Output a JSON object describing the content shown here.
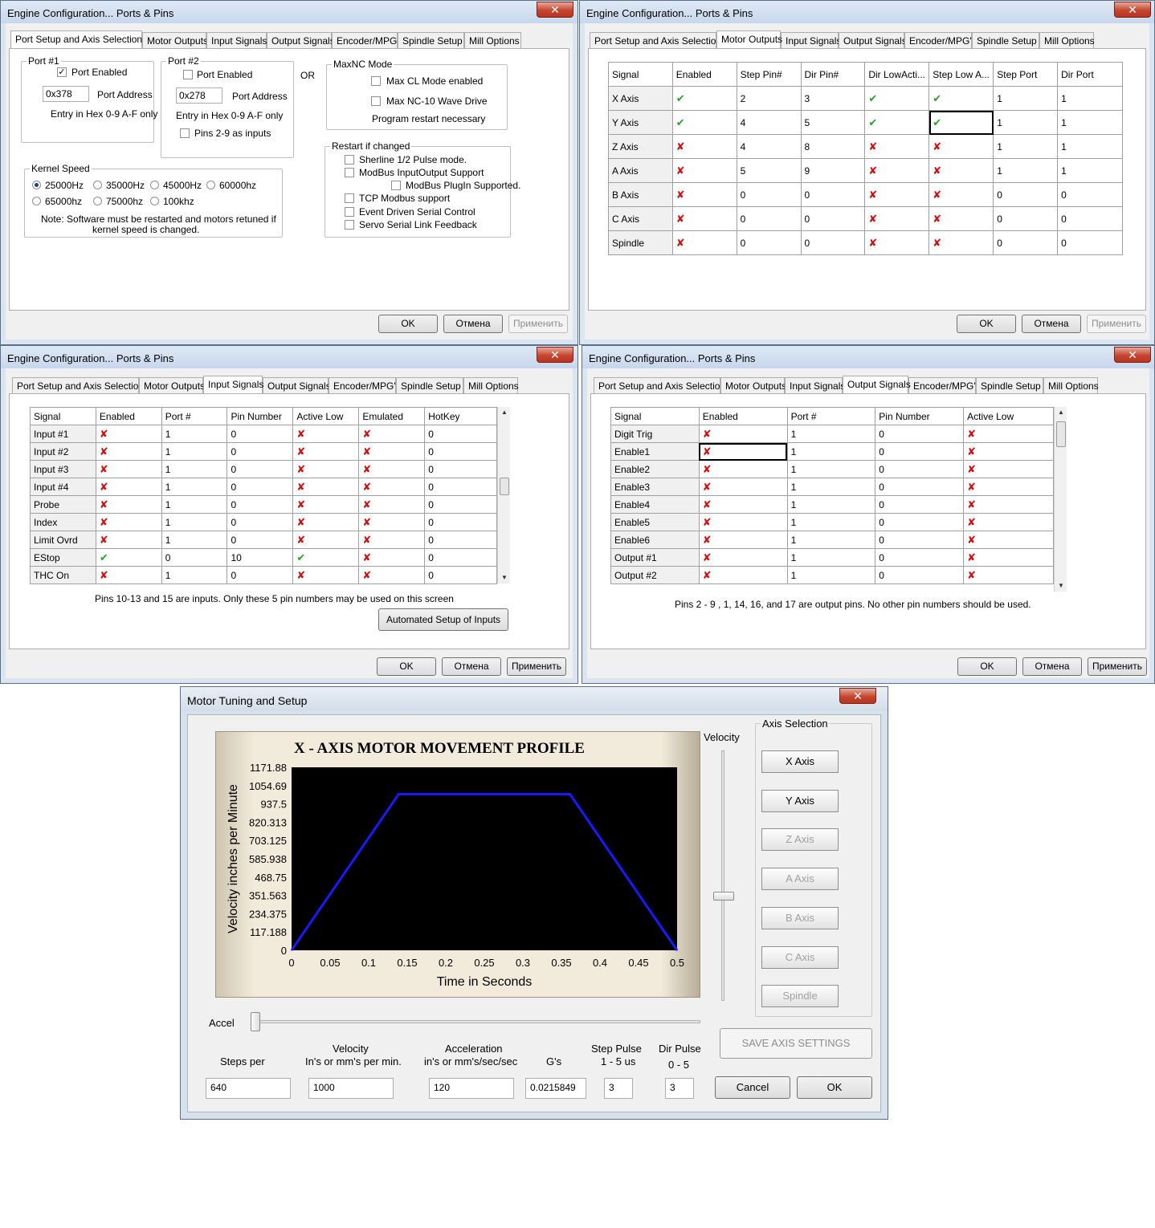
{
  "engine": {
    "title": "Engine Configuration... Ports & Pins",
    "close_glyph": "✕",
    "tabs": [
      "Port Setup and Axis Selection",
      "Motor Outputs",
      "Input Signals",
      "Output Signals",
      "Encoder/MPG's",
      "Spindle Setup",
      "Mill Options"
    ],
    "buttons": {
      "ok": "OK",
      "cancel": "Отмена",
      "apply": "Применить"
    }
  },
  "port_setup": {
    "port1": {
      "label": "Port #1",
      "enabled_label": "Port Enabled",
      "enabled": true,
      "address": "0x378",
      "address_label": "Port Address",
      "hint": "Entry in Hex 0-9 A-F only"
    },
    "or_label": "OR",
    "port2": {
      "label": "Port #2",
      "enabled_label": "Port Enabled",
      "enabled": false,
      "address": "0x278",
      "address_label": "Port Address",
      "hint": "Entry in Hex 0-9 A-F only",
      "pins_label": "Pins 2-9 as inputs"
    },
    "maxnc": {
      "label": "MaxNC Mode",
      "opt1": "Max CL Mode enabled",
      "opt2": "Max NC-10 Wave Drive",
      "note": "Program restart necessary"
    },
    "restart": {
      "label": "Restart if changed",
      "opts": [
        "Sherline 1/2 Pulse mode.",
        "ModBus InputOutput Support",
        "ModBus PlugIn Supported.",
        "TCP Modbus support",
        "Event Driven Serial Control",
        "Servo Serial Link Feedback"
      ]
    },
    "kernel": {
      "label": "Kernel Speed",
      "opts": [
        "25000Hz",
        "35000Hz",
        "45000Hz",
        "60000hz",
        "65000hz",
        "75000hz",
        "100khz"
      ],
      "selected": "25000Hz",
      "note1": "Note: Software must be restarted and motors retuned if",
      "note2": "kernel speed is changed."
    }
  },
  "motor_outputs": {
    "headers": [
      "Signal",
      "Enabled",
      "Step Pin#",
      "Dir Pin#",
      "Dir LowActi...",
      "Step Low A...",
      "Step Port",
      "Dir Port"
    ],
    "rows": [
      [
        "X Axis",
        "y",
        "2",
        "3",
        "y",
        "y",
        "1",
        "1"
      ],
      [
        "Y Axis",
        "y",
        "4",
        "5",
        "y",
        "y",
        "1",
        "1"
      ],
      [
        "Z Axis",
        "n",
        "4",
        "8",
        "n",
        "n",
        "1",
        "1"
      ],
      [
        "A Axis",
        "n",
        "5",
        "9",
        "n",
        "n",
        "1",
        "1"
      ],
      [
        "B Axis",
        "n",
        "0",
        "0",
        "n",
        "n",
        "0",
        "0"
      ],
      [
        "C Axis",
        "n",
        "0",
        "0",
        "n",
        "n",
        "0",
        "0"
      ],
      [
        "Spindle",
        "n",
        "0",
        "0",
        "n",
        "n",
        "0",
        "0"
      ]
    ]
  },
  "input_signals": {
    "headers": [
      "Signal",
      "Enabled",
      "Port #",
      "Pin Number",
      "Active Low",
      "Emulated",
      "HotKey"
    ],
    "rows": [
      [
        "Input #1",
        "n",
        "1",
        "0",
        "n",
        "n",
        "0"
      ],
      [
        "Input #2",
        "n",
        "1",
        "0",
        "n",
        "n",
        "0"
      ],
      [
        "Input #3",
        "n",
        "1",
        "0",
        "n",
        "n",
        "0"
      ],
      [
        "Input #4",
        "n",
        "1",
        "0",
        "n",
        "n",
        "0"
      ],
      [
        "Probe",
        "n",
        "1",
        "0",
        "n",
        "n",
        "0"
      ],
      [
        "Index",
        "n",
        "1",
        "0",
        "n",
        "n",
        "0"
      ],
      [
        "Limit Ovrd",
        "n",
        "1",
        "0",
        "n",
        "n",
        "0"
      ],
      [
        "EStop",
        "y",
        "0",
        "10",
        "y",
        "n",
        "0"
      ],
      [
        "THC On",
        "n",
        "1",
        "0",
        "n",
        "n",
        "0"
      ]
    ],
    "note": "Pins 10-13 and 15 are inputs. Only these 5 pin numbers may be used on this screen",
    "auto_button": "Automated Setup of Inputs"
  },
  "output_signals": {
    "headers": [
      "Signal",
      "Enabled",
      "Port #",
      "Pin Number",
      "Active Low"
    ],
    "rows": [
      [
        "Digit  Trig",
        "n",
        "1",
        "0",
        "n"
      ],
      [
        "Enable1",
        "n",
        "1",
        "0",
        "n"
      ],
      [
        "Enable2",
        "n",
        "1",
        "0",
        "n"
      ],
      [
        "Enable3",
        "n",
        "1",
        "0",
        "n"
      ],
      [
        "Enable4",
        "n",
        "1",
        "0",
        "n"
      ],
      [
        "Enable5",
        "n",
        "1",
        "0",
        "n"
      ],
      [
        "Enable6",
        "n",
        "1",
        "0",
        "n"
      ],
      [
        "Output #1",
        "n",
        "1",
        "0",
        "n"
      ],
      [
        "Output #2",
        "n",
        "1",
        "0",
        "n"
      ]
    ],
    "note": "Pins 2 - 9 , 1, 14, 16, and 17 are output pins.  No  other pin numbers should be used."
  },
  "motor_tuning": {
    "title": "Motor Tuning and Setup",
    "close_glyph": "✕",
    "velocity_label": "Velocity",
    "accel_label": "Accel",
    "axis_group_label": "Axis Selection",
    "axis_buttons": [
      {
        "label": "X Axis",
        "enabled": true
      },
      {
        "label": "Y Axis",
        "enabled": true
      },
      {
        "label": "Z Axis",
        "enabled": false
      },
      {
        "label": "A Axis",
        "enabled": false
      },
      {
        "label": "B Axis",
        "enabled": false
      },
      {
        "label": "C Axis",
        "enabled": false
      },
      {
        "label": "Spindle",
        "enabled": false
      }
    ],
    "save_button": "SAVE AXIS SETTINGS",
    "cancel_button": "Cancel",
    "ok_button": "OK",
    "fields": {
      "steps_label": "Steps per",
      "steps_value": "640",
      "velocity_label1": "Velocity",
      "velocity_label2": "In's or mm's per min.",
      "velocity_value": "1000",
      "accel_label1": "Acceleration",
      "accel_label2": "in's or mm's/sec/sec",
      "accel_value": "120",
      "gs_label": "G's",
      "gs_value": "0.0215849",
      "step_pulse_label1": "Step Pulse",
      "step_pulse_label2": "1 - 5 us",
      "step_pulse_value": "3",
      "dir_pulse_label1": "Dir Pulse",
      "dir_pulse_label2": "0 - 5",
      "dir_pulse_value": "3"
    }
  },
  "chart_data": {
    "type": "line",
    "title": "X - AXIS MOTOR MOVEMENT PROFILE",
    "xlabel": "Time in Seconds",
    "ylabel": "Velocity inches per Minute",
    "xlim": [
      0,
      0.5
    ],
    "ylim": [
      0,
      1171.88
    ],
    "xticks": [
      "0",
      "0.05",
      "0.1",
      "0.15",
      "0.2",
      "0.25",
      "0.3",
      "0.35",
      "0.4",
      "0.45",
      "0.5"
    ],
    "yticks": [
      "0",
      "117.188",
      "234.375",
      "351.563",
      "468.75",
      "585.938",
      "703.125",
      "820.313",
      "937.5",
      "1054.69",
      "1171.88"
    ],
    "series": [
      {
        "x": [
          0,
          0.139,
          0.361,
          0.5
        ],
        "y": [
          0,
          1000,
          1000,
          0
        ]
      }
    ],
    "colors": {
      "background": "#000000",
      "line": "#1a1aff"
    },
    "grid": false
  }
}
